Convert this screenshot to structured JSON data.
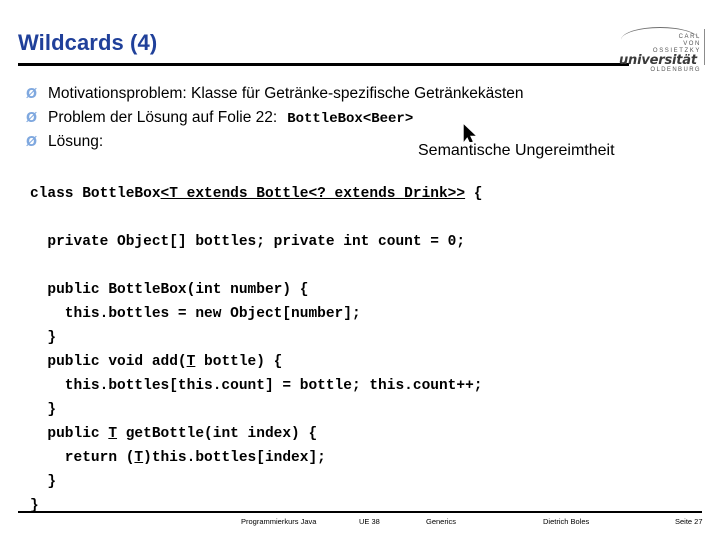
{
  "slide": {
    "title": "Wildcards (4)"
  },
  "logo": {
    "line1": "CARL",
    "line2": "VON",
    "line3": "OSSIETZKY",
    "wordmark": "universität",
    "line4": "OLDENBURG"
  },
  "bullets": [
    {
      "marker": "Ø",
      "text": "Motivationsproblem: Klasse für Getränke-spezifische Getränkekästen",
      "code": ""
    },
    {
      "marker": "Ø",
      "text": "Problem der Lösung auf Folie 22:",
      "code": "BottleBox<Beer>"
    },
    {
      "marker": "Ø",
      "text": "Lösung:",
      "code": ""
    }
  ],
  "annotation": {
    "text": "Semantische Ungereimtheit",
    "cursor": "mouse-pointer"
  },
  "code": {
    "lines": [
      {
        "pre": "class BottleBox",
        "underlined": "<T extends Bottle<? extends Drink>>",
        "post": " {"
      },
      {
        "pre": "",
        "underlined": "",
        "post": ""
      },
      {
        "pre": "  private Object[] bottles; private int count = 0;",
        "underlined": "",
        "post": ""
      },
      {
        "pre": "",
        "underlined": "",
        "post": ""
      },
      {
        "pre": "  public BottleBox(int number) {",
        "underlined": "",
        "post": ""
      },
      {
        "pre": "    this.bottles = new Object[number];",
        "underlined": "",
        "post": ""
      },
      {
        "pre": "  }",
        "underlined": "",
        "post": ""
      },
      {
        "pre": "  public void add(",
        "underlined": "T",
        "post": " bottle) {"
      },
      {
        "pre": "    this.bottles[this.count] = bottle; this.count++;",
        "underlined": "",
        "post": ""
      },
      {
        "pre": "  }",
        "underlined": "",
        "post": ""
      },
      {
        "pre": "  public ",
        "underlined": "T",
        "post": " getBottle(int index) {"
      },
      {
        "pre": "    return (",
        "underlined": "T",
        "post": ")this.bottles[index];"
      },
      {
        "pre": "  }",
        "underlined": "",
        "post": ""
      },
      {
        "pre": "}",
        "underlined": "",
        "post": ""
      }
    ]
  },
  "footer": {
    "items": [
      "Programmierkurs Java",
      "UE 38",
      "Generics",
      "Dietrich Boles",
      "Seite 27"
    ]
  },
  "colors": {
    "title": "#20409A",
    "bullet_marker": "#7FA8DF",
    "rule": "#000000",
    "background": "#FFFFFF"
  }
}
